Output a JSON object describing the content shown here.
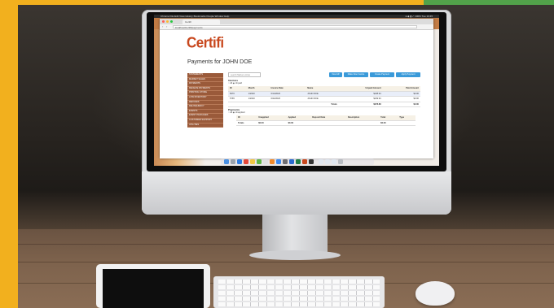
{
  "menubar": {
    "app": "Chrome",
    "menus": "File  Edit  View  History  Bookmarks  People  Window  Help",
    "status": "● ◆ ▮ ✓ 100%  Tue 10:45"
  },
  "browser": {
    "tab_title": "Certifi",
    "url": "localhost/certifi/payments"
  },
  "app": {
    "logo": "Certifi",
    "page_title": "Payments for JOHN DOE",
    "search_placeholder": "search Market entries"
  },
  "toolbar": {
    "buttons": [
      "New AR",
      "Make New Invoice",
      "Create Payment",
      "Apply Payment"
    ]
  },
  "sidebar": {
    "items": [
      "STATEMENTS",
      "MARKET SALES",
      "PAYMENTS",
      "RECEIVE PAYMENTS",
      "PRINTING STORE",
      "LOW INVENTORY",
      "REFUNDS",
      "DELINQUENCY",
      "EVENTS",
      "EVENT PACKAGES",
      "CUSTOMER SUPPORT",
      "UTILITIES"
    ]
  },
  "invoices": {
    "label": "Invoices",
    "radio_all": "All",
    "radio_unpaid": "Unpaid",
    "columns": [
      "ID",
      "Month",
      "Invoice Date",
      "Name",
      "Unpaid Amount",
      "Paid Amount"
    ],
    "rows": [
      [
        "5670",
        "1/2020",
        "6/14/2020",
        "JOHN DOE",
        "$138.94",
        "$0.00"
      ],
      [
        "5765",
        "1/2020",
        "6/22/2020",
        "JOHN DOE",
        "$139.94",
        "$0.00"
      ]
    ],
    "total_label": "Totals",
    "total_unpaid": "$278.88",
    "total_paid": "$0.00"
  },
  "payments": {
    "label": "Payments",
    "radio_all": "All",
    "radio_unapplied": "Unapplied",
    "columns": [
      "ID",
      "Unapplied",
      "Applied",
      "Deposit Date",
      "Description",
      "Total",
      "Type"
    ],
    "total_label": "Totals",
    "total_unapplied": "$0.00",
    "total_applied": "$0.00",
    "total_total": "$0.00"
  },
  "colors": {
    "brand": "#c8481e",
    "sidebar": "#9a5a3a",
    "button": "#3a9ad9",
    "frame_accent": "#f2b01e"
  }
}
